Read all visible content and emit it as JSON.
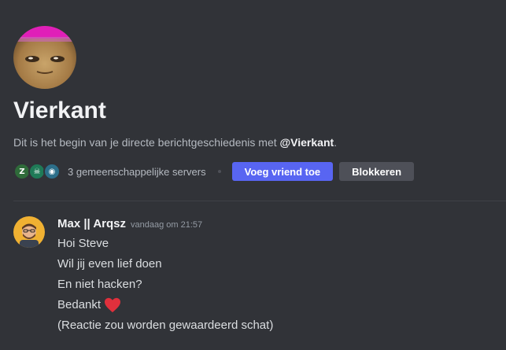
{
  "dm_header": {
    "name": "Vierkant",
    "intro_prefix": "Dit is het begin van je directe berichtgeschiedenis met ",
    "intro_mention": "@Vierkant",
    "intro_suffix": ".",
    "mutual_servers": [
      {
        "icon": "server-z-icon",
        "glyph": "Z",
        "color": "#2f6b3a"
      },
      {
        "icon": "server-reaper-icon",
        "glyph": "☠",
        "color": "#1f7a57"
      },
      {
        "icon": "server-globe-icon",
        "glyph": "◉",
        "color": "#2c6f8a"
      }
    ],
    "mutual_text": "3 gemeenschappelijke servers",
    "add_friend_label": "Voeg vriend toe",
    "block_label": "Blokkeren"
  },
  "colors": {
    "background": "#313338",
    "primary_button": "#5865f2",
    "secondary_button": "#4e5058",
    "heart": "#e0303c"
  },
  "message": {
    "author": "Max || Arqsz",
    "timestamp": "vandaag om 21:57",
    "lines": [
      "Hoi Steve",
      "Wil jij even lief doen",
      "En niet hacken?",
      "Bedankt",
      "(Reactie zou worden gewaardeerd schat)"
    ],
    "emoji_line_index": 3,
    "emoji": "heart-icon"
  }
}
